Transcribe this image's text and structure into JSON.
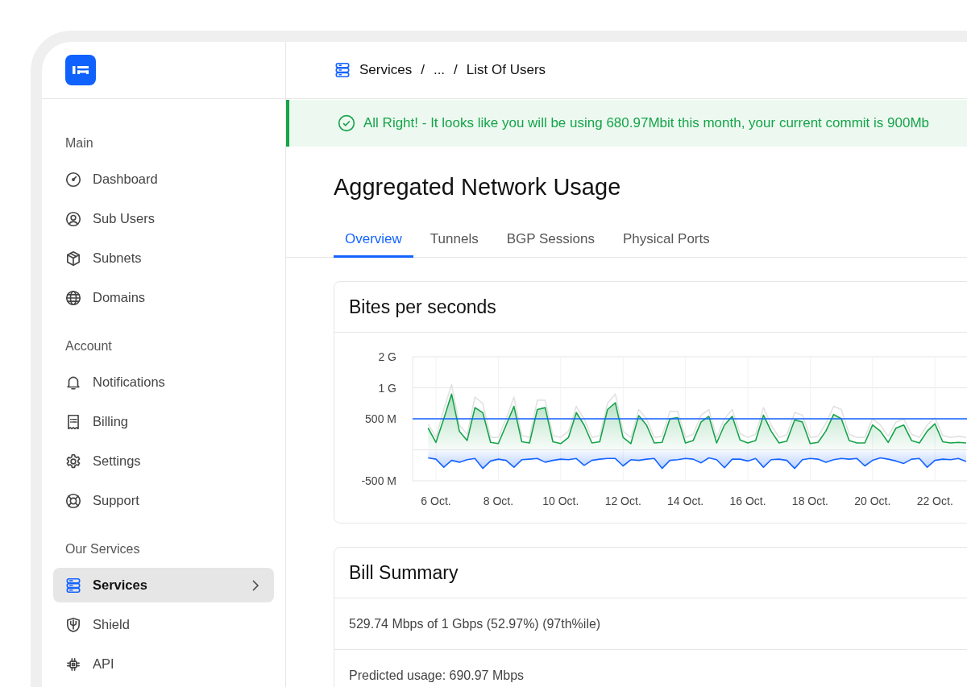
{
  "sidebar": {
    "sections": [
      {
        "title": "Main",
        "items": [
          {
            "label": "Dashboard",
            "selected": false,
            "expandable": false
          },
          {
            "label": "Sub Users",
            "selected": false,
            "expandable": false
          },
          {
            "label": "Subnets",
            "selected": false,
            "expandable": false
          },
          {
            "label": "Domains",
            "selected": false,
            "expandable": false
          }
        ]
      },
      {
        "title": "Account",
        "items": [
          {
            "label": "Notifications",
            "selected": false,
            "expandable": false
          },
          {
            "label": "Billing",
            "selected": false,
            "expandable": false
          },
          {
            "label": "Settings",
            "selected": false,
            "expandable": false
          },
          {
            "label": "Support",
            "selected": false,
            "expandable": false
          }
        ]
      },
      {
        "title": "Our Services",
        "items": [
          {
            "label": "Services",
            "selected": true,
            "expandable": true
          },
          {
            "label": "Shield",
            "selected": false,
            "expandable": false
          },
          {
            "label": "API",
            "selected": false,
            "expandable": false
          }
        ]
      }
    ]
  },
  "breadcrumb": {
    "separator": "/",
    "items": [
      "Services",
      "...",
      "List Of Users"
    ]
  },
  "alert": {
    "kind": "success",
    "text": "All Right! - It looks like you will be using 680.97Mbit this month, your current commit is 900Mb"
  },
  "page_title": "Aggregated Network Usage",
  "tabs": [
    {
      "label": "Overview",
      "selected": true
    },
    {
      "label": "Tunnels",
      "selected": false
    },
    {
      "label": "BGP Sessions",
      "selected": false
    },
    {
      "label": "Physical Ports",
      "selected": false
    }
  ],
  "usage_card": {
    "title": "Bites per seconds",
    "y_axis_labels": [
      "2 G",
      "1 G",
      "500 M",
      "-500 M"
    ],
    "x_axis_labels": [
      "6 Oct.",
      "8 Oct.",
      "10 Oct.",
      "12 Oct.",
      "14 Oct.",
      "16 Oct.",
      "18 Oct.",
      "20 Oct.",
      "22 Oct."
    ]
  },
  "bill_card": {
    "title": "Bill Summary",
    "rows": [
      "529.74 Mbps of 1 Gbps (52.97%) (97th%ile)",
      "Predicted usage: 690.97 Mbps"
    ]
  }
}
